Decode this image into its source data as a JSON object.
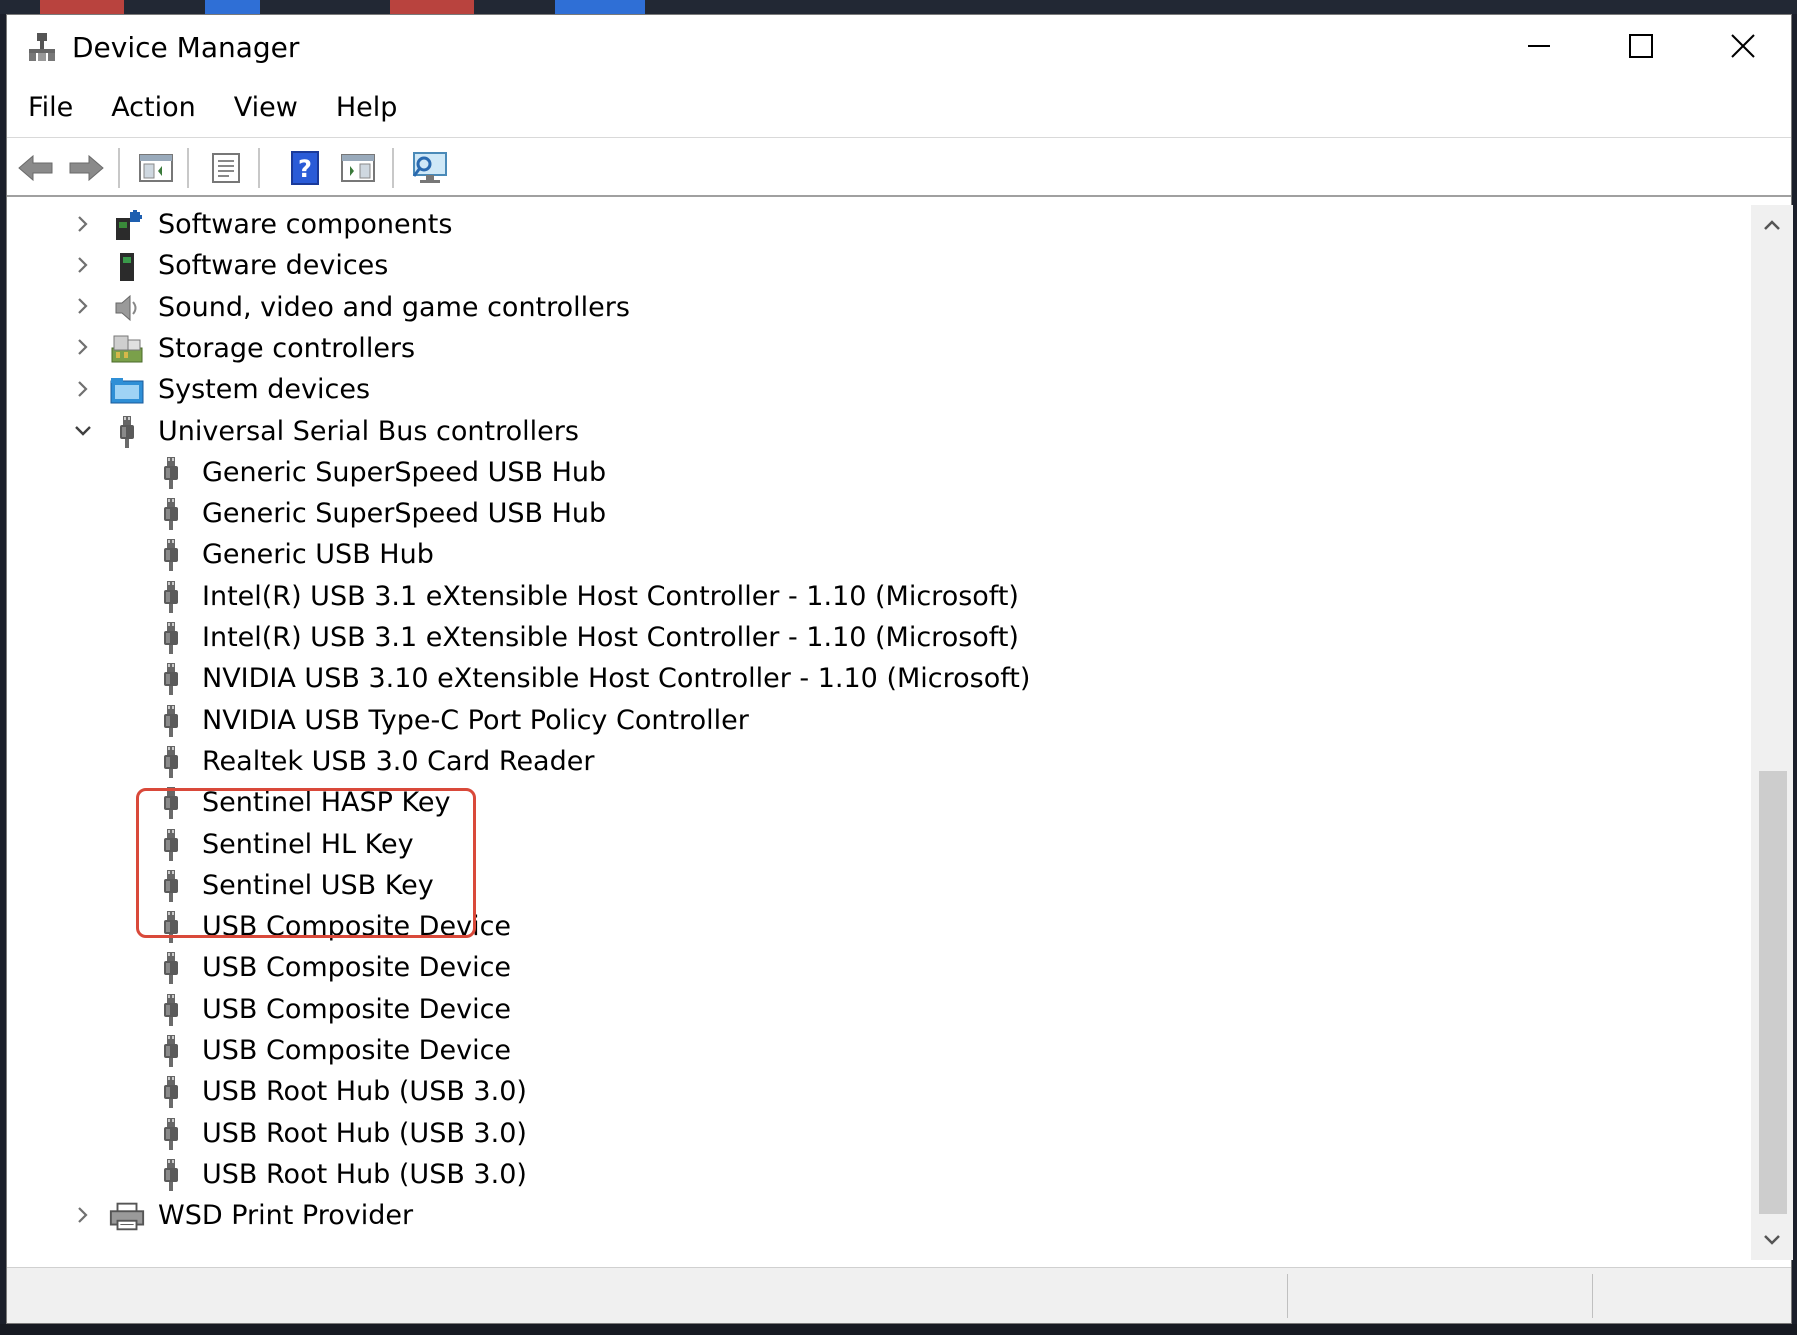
{
  "window": {
    "title": "Device Manager",
    "controls": [
      "minimize-icon",
      "maximize-icon",
      "close-icon"
    ]
  },
  "menu": [
    "File",
    "Action",
    "View",
    "Help"
  ],
  "toolbar": [
    "back-arrow-icon",
    "forward-arrow-icon",
    "show-hide-console-tree-icon",
    "properties-icon",
    "help-icon",
    "run-action-icon",
    "scan-hardware-icon"
  ],
  "tree": {
    "items": [
      {
        "label": "Software components",
        "level": 0,
        "expander": "collapsed",
        "icon": "software-components-icon"
      },
      {
        "label": "Software devices",
        "level": 0,
        "expander": "collapsed",
        "icon": "software-devices-icon"
      },
      {
        "label": "Sound, video and game controllers",
        "level": 0,
        "expander": "collapsed",
        "icon": "speaker-icon"
      },
      {
        "label": "Storage controllers",
        "level": 0,
        "expander": "collapsed",
        "icon": "storage-controller-icon"
      },
      {
        "label": "System devices",
        "level": 0,
        "expander": "collapsed",
        "icon": "system-folder-icon"
      },
      {
        "label": "Universal Serial Bus controllers",
        "level": 0,
        "expander": "expanded",
        "icon": "usb-plug-icon"
      },
      {
        "label": "Generic SuperSpeed USB Hub",
        "level": 1,
        "icon": "usb-plug-icon"
      },
      {
        "label": "Generic SuperSpeed USB Hub",
        "level": 1,
        "icon": "usb-plug-icon"
      },
      {
        "label": "Generic USB Hub",
        "level": 1,
        "icon": "usb-plug-icon"
      },
      {
        "label": "Intel(R) USB 3.1 eXtensible Host Controller - 1.10 (Microsoft)",
        "level": 1,
        "icon": "usb-plug-icon"
      },
      {
        "label": "Intel(R) USB 3.1 eXtensible Host Controller - 1.10 (Microsoft)",
        "level": 1,
        "icon": "usb-plug-icon"
      },
      {
        "label": "NVIDIA USB 3.10 eXtensible Host Controller - 1.10 (Microsoft)",
        "level": 1,
        "icon": "usb-plug-icon"
      },
      {
        "label": "NVIDIA USB Type-C Port Policy Controller",
        "level": 1,
        "icon": "usb-plug-icon"
      },
      {
        "label": "Realtek USB 3.0 Card Reader",
        "level": 1,
        "icon": "usb-plug-icon"
      },
      {
        "label": "Sentinel HASP Key",
        "level": 1,
        "icon": "usb-plug-icon"
      },
      {
        "label": "Sentinel HL Key",
        "level": 1,
        "icon": "usb-plug-icon"
      },
      {
        "label": "Sentinel USB Key",
        "level": 1,
        "icon": "usb-plug-icon"
      },
      {
        "label": "USB Composite Device",
        "level": 1,
        "icon": "usb-plug-icon"
      },
      {
        "label": "USB Composite Device",
        "level": 1,
        "icon": "usb-plug-icon"
      },
      {
        "label": "USB Composite Device",
        "level": 1,
        "icon": "usb-plug-icon"
      },
      {
        "label": "USB Composite Device",
        "level": 1,
        "icon": "usb-plug-icon"
      },
      {
        "label": "USB Root Hub (USB 3.0)",
        "level": 1,
        "icon": "usb-plug-icon"
      },
      {
        "label": "USB Root Hub (USB 3.0)",
        "level": 1,
        "icon": "usb-plug-icon"
      },
      {
        "label": "USB Root Hub (USB 3.0)",
        "level": 1,
        "icon": "usb-plug-icon"
      },
      {
        "label": "WSD Print Provider",
        "level": 0,
        "expander": "collapsed",
        "icon": "printer-icon"
      }
    ],
    "highlighted": [
      "Sentinel HASP Key",
      "Sentinel HL Key",
      "Sentinel USB Key"
    ]
  },
  "colors": {
    "highlight_border": "#d9493a",
    "help_icon_blue": "#2a5bd7"
  }
}
